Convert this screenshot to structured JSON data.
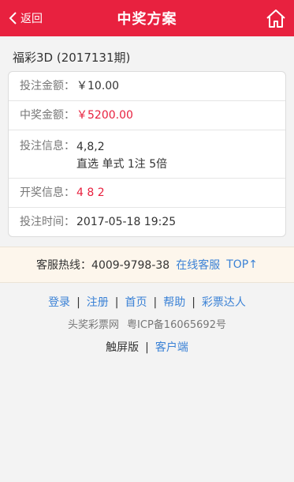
{
  "header": {
    "back_label": "返回",
    "title": "中奖方案"
  },
  "lottery": {
    "name": "福彩3D (2017131期)"
  },
  "details": {
    "bet_amount_label": "投注金额：",
    "bet_amount": "￥10.00",
    "win_amount_label": "中奖金额：",
    "win_amount": "￥5200.00",
    "bet_info_label": "投注信息：",
    "bet_numbers": "4,8,2",
    "bet_detail": "直选 单式 1注 5倍",
    "draw_info_label": "开奖信息：",
    "draw_numbers": "4 8 2",
    "bet_time_label": "投注时间：",
    "bet_time": "2017-05-18 19:25"
  },
  "service": {
    "hotline": "客服热线：4009-9798-38",
    "online_service": "在线客服",
    "top": "TOP↑"
  },
  "footer": {
    "links": [
      "登录",
      "注册",
      "首页",
      "帮助",
      "彩票达人"
    ],
    "separator": "|",
    "site_name": "头奖彩票网",
    "icp": "粤ICP备16065692号",
    "touch_version": "触屏版",
    "client": "客户端"
  },
  "colors": {
    "brand_red": "#e8213f",
    "link_blue": "#3b82d6"
  }
}
